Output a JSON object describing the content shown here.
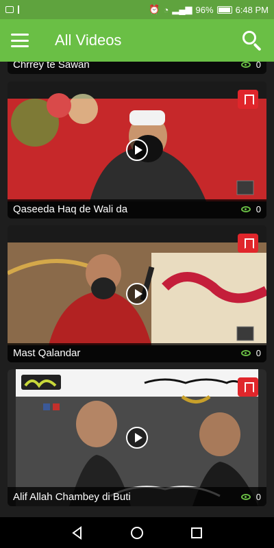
{
  "status_bar": {
    "battery": "96%",
    "time": "6:48 PM"
  },
  "app_bar": {
    "title": "All Videos"
  },
  "videos": [
    {
      "title": "Chrrey te Sawan",
      "views": "0"
    },
    {
      "title": "Qaseeda Haq de Wali da",
      "views": "0"
    },
    {
      "title": "Mast Qalandar",
      "views": "0"
    },
    {
      "title": "Alif Allah Chambey di Buti",
      "views": "0"
    }
  ],
  "colors": {
    "accent": "#6abf45",
    "status_bar": "#5fa33e",
    "bookmark": "#e0262b",
    "background": "#1e1e1e"
  },
  "icons": {
    "menu": "hamburger-icon",
    "search": "search-icon",
    "bookmark": "bookmark-icon",
    "views": "eye-icon",
    "play": "play-icon"
  }
}
